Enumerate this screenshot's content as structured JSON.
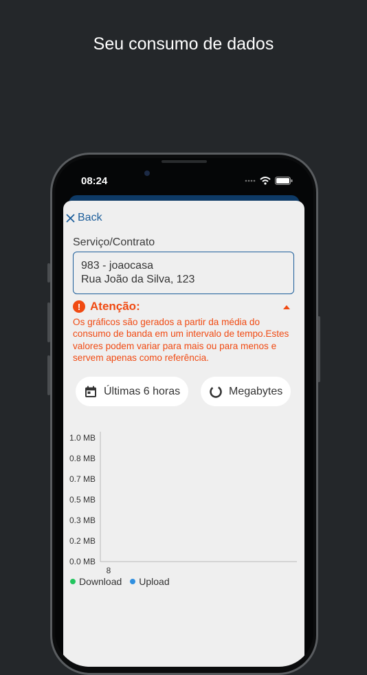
{
  "headline": "Seu consumo de dados",
  "status_bar": {
    "time": "08:24"
  },
  "nav": {
    "back_label": "Back"
  },
  "service": {
    "label": "Serviço/Contrato",
    "line1": "983 - joaocasa",
    "line2": "Rua João da Silva, 123"
  },
  "attention": {
    "title": "Atenção:",
    "text": "Os gráficos são gerados a partir da média do consumo de banda em um intervalo de tempo.Estes valores podem variar para mais ou para menos e servem apenas como referência."
  },
  "filters": {
    "period_label": "Últimas 6 horas",
    "unit_label": "Megabytes"
  },
  "chart_data": {
    "type": "line",
    "x": [
      "8"
    ],
    "y_ticks": [
      "1.0 MB",
      "0.8 MB",
      "0.7 MB",
      "0.5 MB",
      "0.3 MB",
      "0.2 MB",
      "0.0 MB"
    ],
    "ylim": [
      0,
      1.0
    ],
    "series": [
      {
        "name": "Download",
        "values": [],
        "color": "#22c55e"
      },
      {
        "name": "Upload",
        "values": [],
        "color": "#2f8fe0"
      }
    ]
  },
  "colors": {
    "accent": "#1b5d9a",
    "warning": "#f04a12",
    "background": "#24272a"
  }
}
